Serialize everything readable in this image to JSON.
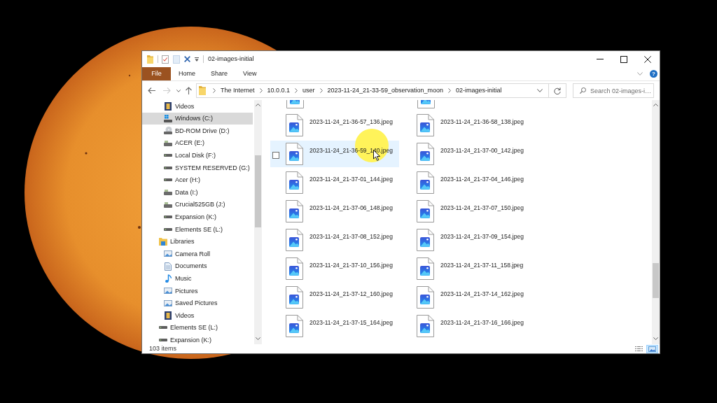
{
  "window": {
    "title": "02-images-initial"
  },
  "ribbon": {
    "tabs": [
      {
        "label": "File",
        "kind": "file",
        "selected": false
      },
      {
        "label": "Home",
        "kind": "tab",
        "selected": false
      },
      {
        "label": "Share",
        "kind": "tab",
        "selected": false
      },
      {
        "label": "View",
        "kind": "tab",
        "selected": false
      }
    ],
    "help": "?"
  },
  "address_bar": {
    "nav_buttons": [
      {
        "kind": "back",
        "disabled": false
      },
      {
        "kind": "forward",
        "disabled": true
      },
      {
        "kind": "recent",
        "disabled": false
      },
      {
        "kind": "up",
        "disabled": false
      }
    ],
    "breadcrumbs": [
      "The Internet",
      "10.0.0.1",
      "user",
      "2023-11-24_21-33-59_observation_moon",
      "02-images-initial"
    ]
  },
  "search": {
    "placeholder": "Search 02-images-i…"
  },
  "nav_pane": {
    "continued_children": [
      {
        "label": "Videos",
        "kind": "videos",
        "selected": false
      },
      {
        "label": "Windows (C:)",
        "kind": "sysdrive",
        "selected": true
      },
      {
        "label": "BD-ROM Drive (D:)",
        "kind": "disc",
        "selected": false
      },
      {
        "label": "ACER (E:)",
        "kind": "hdd",
        "selected": false
      },
      {
        "label": "Local Disk (F:)",
        "kind": "drive",
        "selected": false
      },
      {
        "label": "SYSTEM RESERVED (G:)",
        "kind": "drive",
        "selected": false
      },
      {
        "label": "Acer (H:)",
        "kind": "drive",
        "selected": false
      },
      {
        "label": "Data (I:)",
        "kind": "hdd",
        "selected": false
      },
      {
        "label": "Crucial525GB (J:)",
        "kind": "hdd",
        "selected": false
      },
      {
        "label": "Expansion (K:)",
        "kind": "drive",
        "selected": false
      },
      {
        "label": "Elements SE (L:)",
        "kind": "drive",
        "selected": false
      }
    ],
    "items": [
      {
        "label": "Libraries",
        "kind": "library",
        "selected": false,
        "children": [
          {
            "label": "Camera Roll",
            "kind": "pictures",
            "selected": false
          },
          {
            "label": "Documents",
            "kind": "documents",
            "selected": false
          },
          {
            "label": "Music",
            "kind": "music",
            "selected": false
          },
          {
            "label": "Pictures",
            "kind": "pictures",
            "selected": false
          },
          {
            "label": "Saved Pictures",
            "kind": "pictures",
            "selected": false
          },
          {
            "label": "Videos",
            "kind": "videos",
            "selected": false
          }
        ]
      },
      {
        "label": "Elements SE (L:)",
        "kind": "drive",
        "selected": false
      },
      {
        "label": "Expansion (K:)",
        "kind": "drive",
        "selected": false
      }
    ]
  },
  "files": [
    {
      "kind": "partial",
      "hovered": false,
      "checked": false
    },
    {
      "kind": "partial",
      "hovered": false,
      "checked": false
    },
    {
      "kind": "file",
      "name": "2023-11-24_21-36-57_136.jpeg",
      "hovered": false,
      "checked": false
    },
    {
      "kind": "file",
      "name": "2023-11-24_21-36-58_138.jpeg",
      "hovered": false,
      "checked": false
    },
    {
      "kind": "file",
      "name": "2023-11-24_21-36-59_140.jpeg",
      "hovered": true,
      "checked": false
    },
    {
      "kind": "file",
      "name": "2023-11-24_21-37-00_142.jpeg",
      "hovered": false,
      "checked": false
    },
    {
      "kind": "file",
      "name": "2023-11-24_21-37-01_144.jpeg",
      "hovered": false,
      "checked": false
    },
    {
      "kind": "file",
      "name": "2023-11-24_21-37-04_146.jpeg",
      "hovered": false,
      "checked": false
    },
    {
      "kind": "file",
      "name": "2023-11-24_21-37-06_148.jpeg",
      "hovered": false,
      "checked": false
    },
    {
      "kind": "file",
      "name": "2023-11-24_21-37-07_150.jpeg",
      "hovered": false,
      "checked": false
    },
    {
      "kind": "file",
      "name": "2023-11-24_21-37-08_152.jpeg",
      "hovered": false,
      "checked": false
    },
    {
      "kind": "file",
      "name": "2023-11-24_21-37-09_154.jpeg",
      "hovered": false,
      "checked": false
    },
    {
      "kind": "file",
      "name": "2023-11-24_21-37-10_156.jpeg",
      "hovered": false,
      "checked": false
    },
    {
      "kind": "file",
      "name": "2023-11-24_21-37-11_158.jpeg",
      "hovered": false,
      "checked": false
    },
    {
      "kind": "file",
      "name": "2023-11-24_21-37-12_160.jpeg",
      "hovered": false,
      "checked": false
    },
    {
      "kind": "file",
      "name": "2023-11-24_21-37-14_162.jpeg",
      "hovered": false,
      "checked": false
    },
    {
      "kind": "file",
      "name": "2023-11-24_21-37-15_164.jpeg",
      "hovered": false,
      "checked": false
    },
    {
      "kind": "file",
      "name": "2023-11-24_21-37-16_166.jpeg",
      "hovered": false,
      "checked": false
    }
  ],
  "mouse_pointer": {
    "highlight": true
  },
  "status_bar": {
    "count": "103 items",
    "views": [
      {
        "kind": "details",
        "selected": false
      },
      {
        "kind": "icons",
        "selected": true
      }
    ]
  }
}
